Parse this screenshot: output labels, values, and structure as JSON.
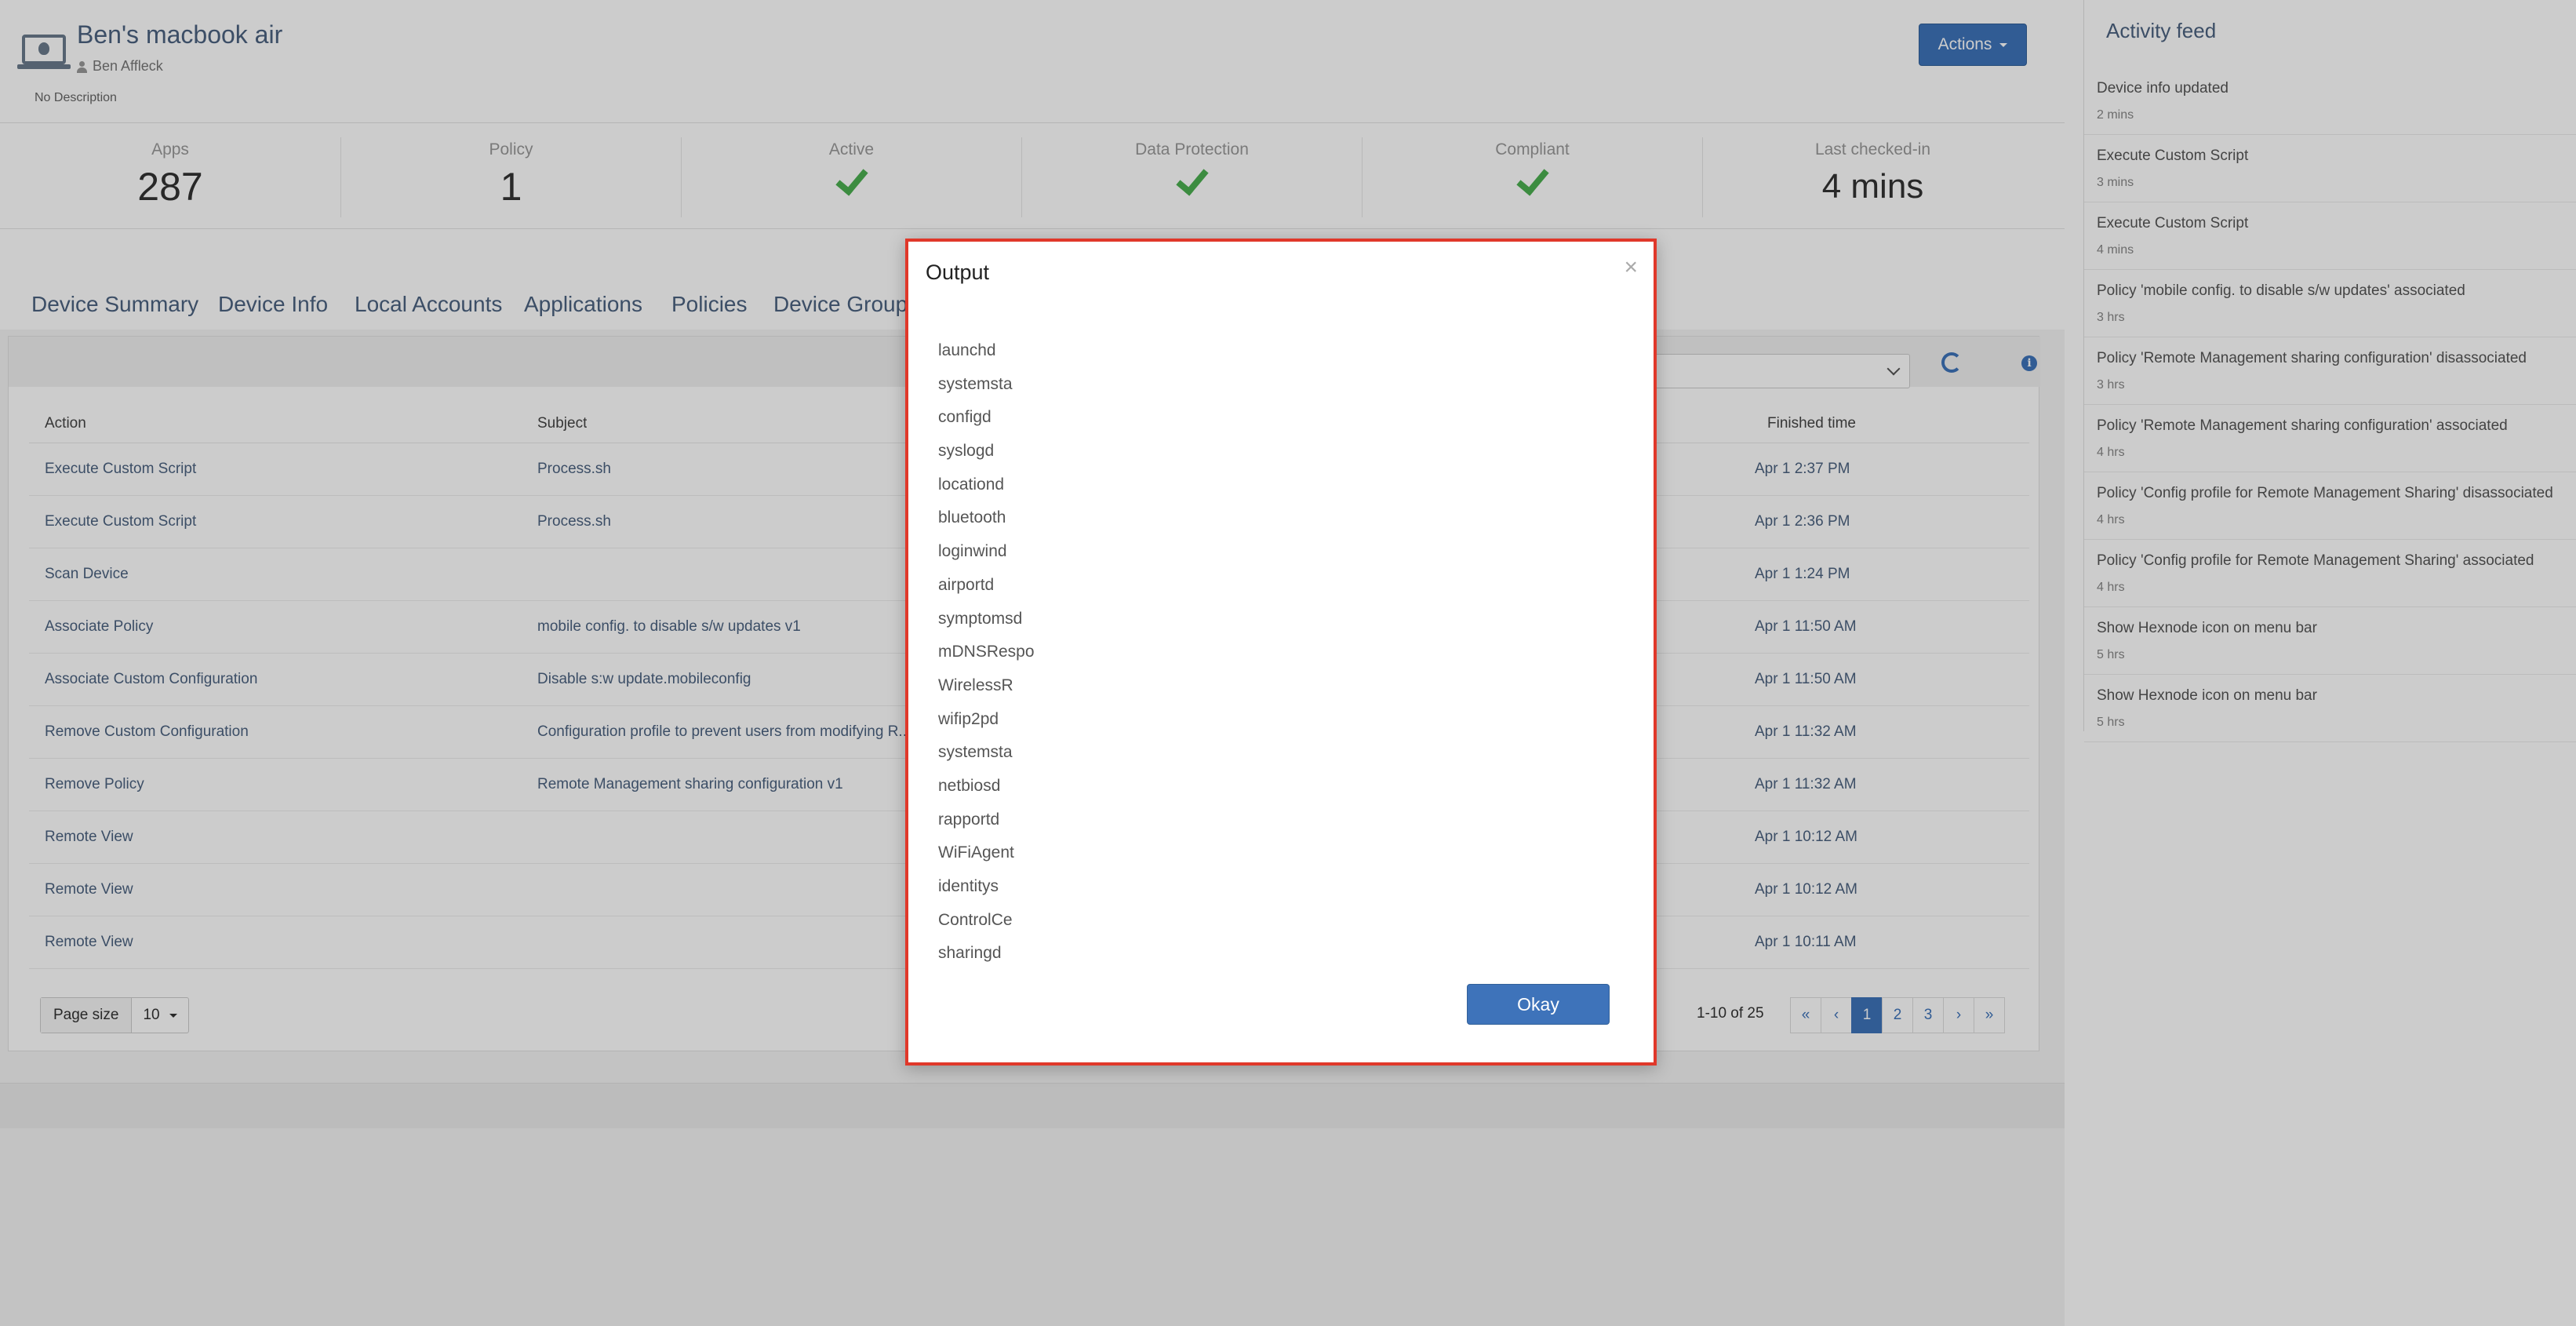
{
  "header": {
    "device_title": "Ben's macbook air",
    "owner": "Ben Affleck",
    "description": "No Description",
    "actions_label": "Actions"
  },
  "stats": [
    {
      "label": "Apps",
      "value": "287"
    },
    {
      "label": "Policy",
      "value": "1"
    },
    {
      "label": "Active",
      "status": "check"
    },
    {
      "label": "Data Protection",
      "status": "check"
    },
    {
      "label": "Compliant",
      "status": "check"
    },
    {
      "label": "Last checked-in",
      "value": "4 mins"
    }
  ],
  "tabs": [
    "Device Summary",
    "Device Info",
    "Local Accounts",
    "Applications",
    "Policies",
    "Device Groups"
  ],
  "table": {
    "headers": {
      "action": "Action",
      "subject": "Subject",
      "finished": "Finished time"
    },
    "rows": [
      {
        "action": "Execute Custom Script",
        "subject": "Process.sh",
        "finished": "Apr 1 2:37 PM"
      },
      {
        "action": "Execute Custom Script",
        "subject": "Process.sh",
        "finished": "Apr 1 2:36 PM"
      },
      {
        "action": "Scan Device",
        "subject": "",
        "finished": "Apr 1 1:24 PM"
      },
      {
        "action": "Associate Policy",
        "subject": "mobile config. to disable s/w updates v1",
        "finished": "Apr 1 11:50 AM"
      },
      {
        "action": "Associate Custom Configuration",
        "subject": "Disable s:w update.mobileconfig",
        "finished": "Apr 1 11:50 AM"
      },
      {
        "action": "Remove Custom Configuration",
        "subject": "Configuration profile to prevent users from modifying R...",
        "finished": "Apr 1 11:32 AM"
      },
      {
        "action": "Remove Policy",
        "subject": "Remote Management sharing configuration v1",
        "finished": "Apr 1 11:32 AM"
      },
      {
        "action": "Remote View",
        "subject": "",
        "finished": "Apr 1 10:12 AM"
      },
      {
        "action": "Remote View",
        "subject": "",
        "finished": "Apr 1 10:12 AM"
      },
      {
        "action": "Remote View",
        "subject": "",
        "finished": "Apr 1 10:11 AM"
      }
    ]
  },
  "pagination": {
    "page_size_label": "Page size",
    "page_size_value": "10",
    "count_text": "1-10 of 25",
    "buttons": [
      "«",
      "‹",
      "1",
      "2",
      "3",
      "›",
      "»"
    ],
    "active_page": "1"
  },
  "activity_feed": {
    "title": "Activity feed",
    "items": [
      {
        "text": "Device info updated",
        "time": "2 mins"
      },
      {
        "text": "Execute Custom Script",
        "time": "3 mins"
      },
      {
        "text": "Execute Custom Script",
        "time": "4 mins"
      },
      {
        "text": "Policy 'mobile config. to disable s/w updates' associated",
        "time": "3 hrs"
      },
      {
        "text": "Policy 'Remote Management sharing configuration' disassociated",
        "time": "3 hrs"
      },
      {
        "text": "Policy 'Remote Management sharing configuration' associated",
        "time": "4 hrs"
      },
      {
        "text": "Policy 'Config profile for Remote Management Sharing' disassociated",
        "time": "4 hrs"
      },
      {
        "text": "Policy 'Config profile for Remote Management Sharing' associated",
        "time": "4 hrs"
      },
      {
        "text": "Show Hexnode icon on menu bar",
        "time": "5 hrs"
      },
      {
        "text": "Show Hexnode icon on menu bar",
        "time": "5 hrs"
      }
    ]
  },
  "modal": {
    "title": "Output",
    "close_symbol": "×",
    "lines": [
      "launchd",
      "systemsta",
      "configd",
      "syslogd",
      "locationd",
      "bluetooth",
      "loginwind",
      "airportd",
      "symptomsd",
      "mDNSRespo",
      "WirelessR",
      "wifip2pd",
      "systemsta",
      "netbiosd",
      "rapportd",
      "WiFiAgent",
      "identitys",
      "ControlCe",
      "sharingd"
    ],
    "okay_label": "Okay"
  },
  "icons": {
    "device": "laptop-icon",
    "owner": "user-icon",
    "status": "check-icon",
    "refresh": "refresh-icon",
    "info": "info-icon",
    "close": "close-icon"
  },
  "colors": {
    "accent": "#3e73ba",
    "check": "#4caf50",
    "modal_highlight": "#e0382a"
  }
}
